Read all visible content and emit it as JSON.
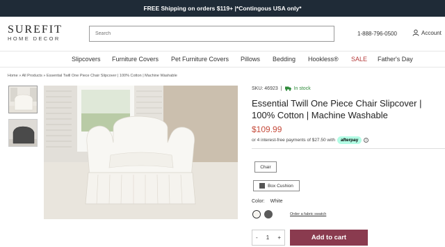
{
  "promo": {
    "text": "FREE Shipping on orders $119+ |*Contingous USA only*"
  },
  "header": {
    "logo_top": "SUREFIT",
    "logo_bottom": "HOME DECOR",
    "search_placeholder": "Search",
    "phone": "1-888-796-0500",
    "account_label": "Account"
  },
  "nav": {
    "items": [
      {
        "label": "Slipcovers"
      },
      {
        "label": "Furniture Covers"
      },
      {
        "label": "Pet Furniture Covers"
      },
      {
        "label": "Pillows"
      },
      {
        "label": "Bedding"
      },
      {
        "label": "Hookless®"
      },
      {
        "label": "SALE"
      },
      {
        "label": "Father's Day"
      }
    ]
  },
  "breadcrumb": "Home  »  All Products  »  Essential Twill One Piece Chair Slipcover | 100% Cotton | Machine Washable",
  "product": {
    "sku": "SKU: 46923",
    "stock": "In stock",
    "title": "Essential Twill One Piece Chair Slipcover | 100% Cotton | Machine Washable",
    "price": "$109.99",
    "afterpay_text": "or 4 interest-free payments of $27.50 with",
    "afterpay_badge": "afterpay",
    "option_chair": "Chair",
    "option_box_cushion": "Box Cushion",
    "color_label": "Color:",
    "color_value": "White",
    "swatch_link": "Order a fabric swatch",
    "quantity": "1",
    "qty_minus": "-",
    "qty_plus": "+",
    "add_to_cart": "Add to cart"
  },
  "colors": {
    "promo_bg": "#1f2b37",
    "price": "#c54a3a",
    "in_stock": "#2e8b3a",
    "sale": "#b43a3a",
    "add_to_cart": "#8a3b4f",
    "afterpay_badge": "#b2fce4"
  },
  "icons": {
    "account": "user-icon",
    "stock": "truck-icon",
    "info": "info-icon",
    "box_cushion": "cushion-swatch-icon"
  }
}
